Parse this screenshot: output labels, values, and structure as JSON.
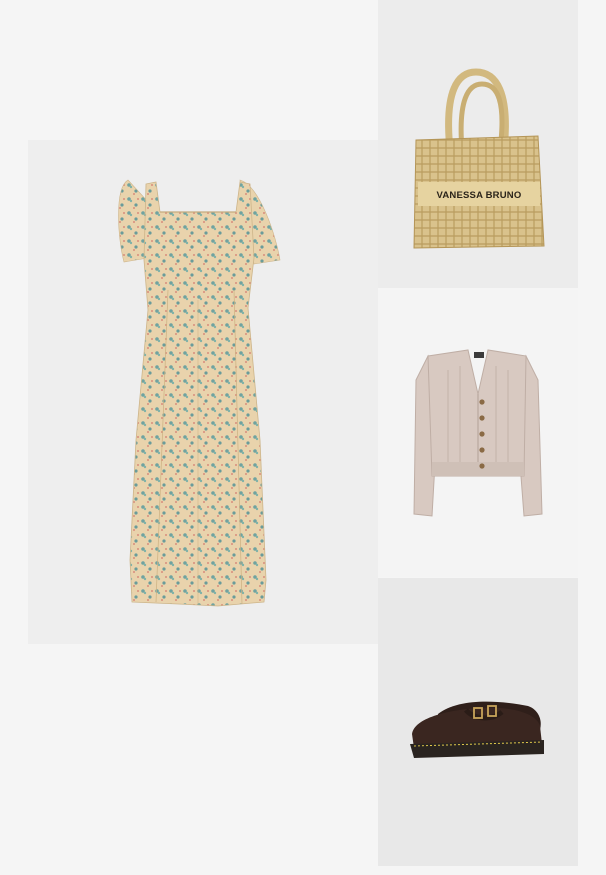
{
  "items": [
    {
      "kind": "dress",
      "brand_print": "",
      "colors": {
        "base": "#e9d3ac",
        "print_blue": "#6fa3a0",
        "print_pink": "#d98d7c"
      }
    },
    {
      "kind": "tote-bag",
      "brand_print": "VANESSA BRUNO",
      "colors": {
        "straw": "#d9c28c",
        "straw_dark": "#b99d5f"
      }
    },
    {
      "kind": "cardigan",
      "brand_print": "",
      "colors": {
        "knit": "#d8c9c1",
        "knit_dark": "#bfaea5",
        "buttons": "#8a6a45"
      }
    },
    {
      "kind": "shoes",
      "brand_print": "",
      "colors": {
        "leather": "#3a2620",
        "sole": "#2a2420",
        "stitch": "#e0c84a",
        "buckle": "#c8a45a"
      }
    }
  ]
}
